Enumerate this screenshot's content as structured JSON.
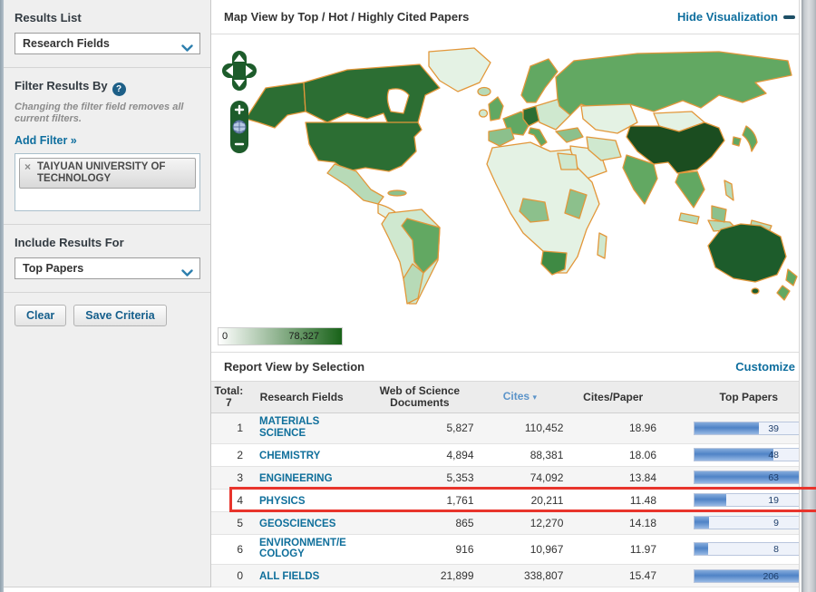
{
  "sidebar": {
    "results_list_label": "Results List",
    "results_list_value": "Research Fields",
    "filter_title": "Filter Results By",
    "filter_note": "Changing the filter field removes all current filters.",
    "add_filter_label": "Add Filter »",
    "filter_tag": "TAIYUAN UNIVERSITY OF TECHNOLOGY",
    "include_results_label": "Include Results For",
    "include_results_value": "Top Papers",
    "clear_button": "Clear",
    "save_button": "Save Criteria"
  },
  "map": {
    "title": "Map View by Top / Hot / Highly Cited Papers",
    "hide_link": "Hide Visualization",
    "legend_min": "0",
    "legend_max": "78,327",
    "palette": {
      "border": "#e2973a",
      "darkest": "#1b4d20",
      "dark": "#2c6e33",
      "medium": "#62a862",
      "light": "#b7dab7",
      "pale": "#e4f2e4"
    }
  },
  "report": {
    "title": "Report View by Selection",
    "customize_link": "Customize",
    "table": {
      "total_label": "Total:",
      "total_value": "7",
      "headers": {
        "field": "Research Fields",
        "documents": "Web of Science Documents",
        "cites": "Cites",
        "cites_per_paper": "Cites/Paper",
        "top_papers": "Top Papers"
      },
      "sorted_by": "Cites",
      "rows": [
        {
          "rank": "1",
          "field": "MATERIALS SCIENCE",
          "documents": "5,827",
          "cites": "110,452",
          "cites_per_paper": "18.96",
          "top_papers": "39",
          "bar_pct": 62,
          "highlighted": false
        },
        {
          "rank": "2",
          "field": "CHEMISTRY",
          "documents": "4,894",
          "cites": "88,381",
          "cites_per_paper": "18.06",
          "top_papers": "48",
          "bar_pct": 76,
          "highlighted": false
        },
        {
          "rank": "3",
          "field": "ENGINEERING",
          "documents": "5,353",
          "cites": "74,092",
          "cites_per_paper": "13.84",
          "top_papers": "63",
          "bar_pct": 100,
          "highlighted": false
        },
        {
          "rank": "4",
          "field": "PHYSICS",
          "documents": "1,761",
          "cites": "20,211",
          "cites_per_paper": "11.48",
          "top_papers": "19",
          "bar_pct": 30,
          "highlighted": true
        },
        {
          "rank": "5",
          "field": "GEOSCIENCES",
          "documents": "865",
          "cites": "12,270",
          "cites_per_paper": "14.18",
          "top_papers": "9",
          "bar_pct": 14,
          "highlighted": false
        },
        {
          "rank": "6",
          "field": "ENVIRONMENT/ECOLOGY",
          "documents": "916",
          "cites": "10,967",
          "cites_per_paper": "11.97",
          "top_papers": "8",
          "bar_pct": 13,
          "highlighted": false
        },
        {
          "rank": "0",
          "field": "ALL FIELDS",
          "documents": "21,899",
          "cites": "338,807",
          "cites_per_paper": "15.47",
          "top_papers": "206",
          "bar_pct": 100,
          "highlighted": false
        }
      ],
      "highlight_color": "#e8342c",
      "bar_fill_color": "#4f83c6"
    }
  }
}
